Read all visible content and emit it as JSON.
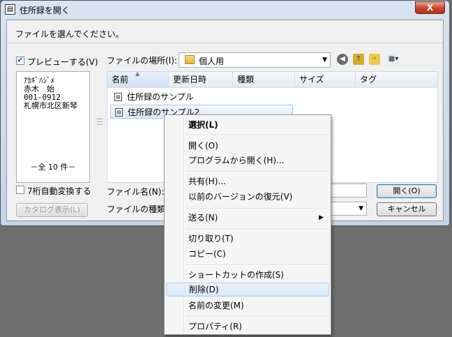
{
  "window": {
    "title": "住所録を開く",
    "close_glyph": "X",
    "title_icon": "address-book-icon"
  },
  "dialog": {
    "instruction": "ファイルを選んでください。",
    "preview_checkbox": {
      "label": "プレビューする(V)",
      "checked": true
    },
    "preview": {
      "lines": [
        "ｱｶｷﾞﾊｼﾞﾒ",
        "赤木　始",
        "001-0912",
        "札幌市北区新琴"
      ],
      "count": "－全 10 件－"
    },
    "seven_digit_checkbox": {
      "label": "7桁自動変換する",
      "checked": false
    },
    "catalog_button": "カタログ表示(L)",
    "location_label": "ファイルの場所(I):",
    "location_value": "個人用",
    "columns": [
      "名前",
      "更新日時",
      "種類",
      "サイズ",
      "タグ"
    ],
    "files": [
      "住所録のサンプル",
      "住所録のサンプル2"
    ],
    "filename_label": "ファイル名(N):",
    "filetype_label": "ファイルの種類(T):",
    "open_button": "開く(O)",
    "cancel_button": "キャンセル"
  },
  "context_menu": {
    "items": [
      {
        "label": "選択(L)",
        "bold": true
      },
      {
        "label": "開く(O)"
      },
      {
        "label": "プログラムから開く(H)..."
      },
      {
        "label": "共有(H)..."
      },
      {
        "label": "以前のバージョンの復元(V)"
      },
      {
        "label": "送る(N)",
        "submenu": true
      },
      {
        "label": "切り取り(T)"
      },
      {
        "label": "コピー(C)"
      },
      {
        "label": "ショートカットの作成(S)"
      },
      {
        "label": "削除(D)",
        "highlighted": true
      },
      {
        "label": "名前の変更(M)"
      },
      {
        "label": "プロパティ(R)"
      }
    ]
  },
  "colors": {
    "accent": "#3c7fb1",
    "close": "#c7422a",
    "dialog_bg": "#f0f0f0"
  }
}
